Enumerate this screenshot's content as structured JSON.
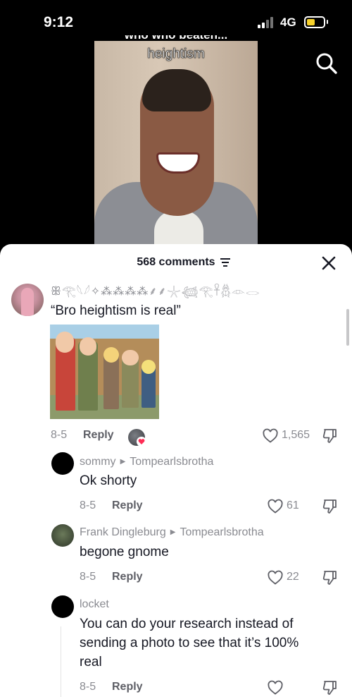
{
  "status_bar": {
    "time": "9:12",
    "network": "4G"
  },
  "video": {
    "caption": "heightism",
    "caption_cut": "who who beaten..."
  },
  "comments": {
    "count_label": "568 comments",
    "main": {
      "username": "ꕥ𓂀𓆩𓆪✧⁂⁂⁂⁂⸙⸙𓇼𓆉𓂀𓋹𓆣𓁹𓂋",
      "text": "“Bro heightism is real”",
      "date": "8-5",
      "reply_label": "Reply",
      "likes": "1,565"
    },
    "replies": [
      {
        "username": "sommy",
        "reply_to": "Tompearlsbrotha",
        "text": "Ok shorty",
        "date": "8-5",
        "reply_label": "Reply",
        "likes": "61"
      },
      {
        "username": "Frank Dingleburg",
        "reply_to": "Tompearlsbrotha",
        "text": "begone gnome",
        "date": "8-5",
        "reply_label": "Reply",
        "likes": "22"
      },
      {
        "username": "locket",
        "text_lines": [
          "You can do your research instead of",
          "sending a photo to see that it’s 100%",
          "real"
        ],
        "date": "8-5",
        "reply_label": "Reply",
        "likes": ""
      }
    ]
  },
  "colors": {
    "battery": "#f7d22c",
    "like_badge": "#fe2c55"
  },
  "icons": {
    "search": "search-icon",
    "filter": "filter-icon",
    "close": "close-icon",
    "heart": "heart-icon",
    "dislike": "thumbs-down-icon"
  }
}
